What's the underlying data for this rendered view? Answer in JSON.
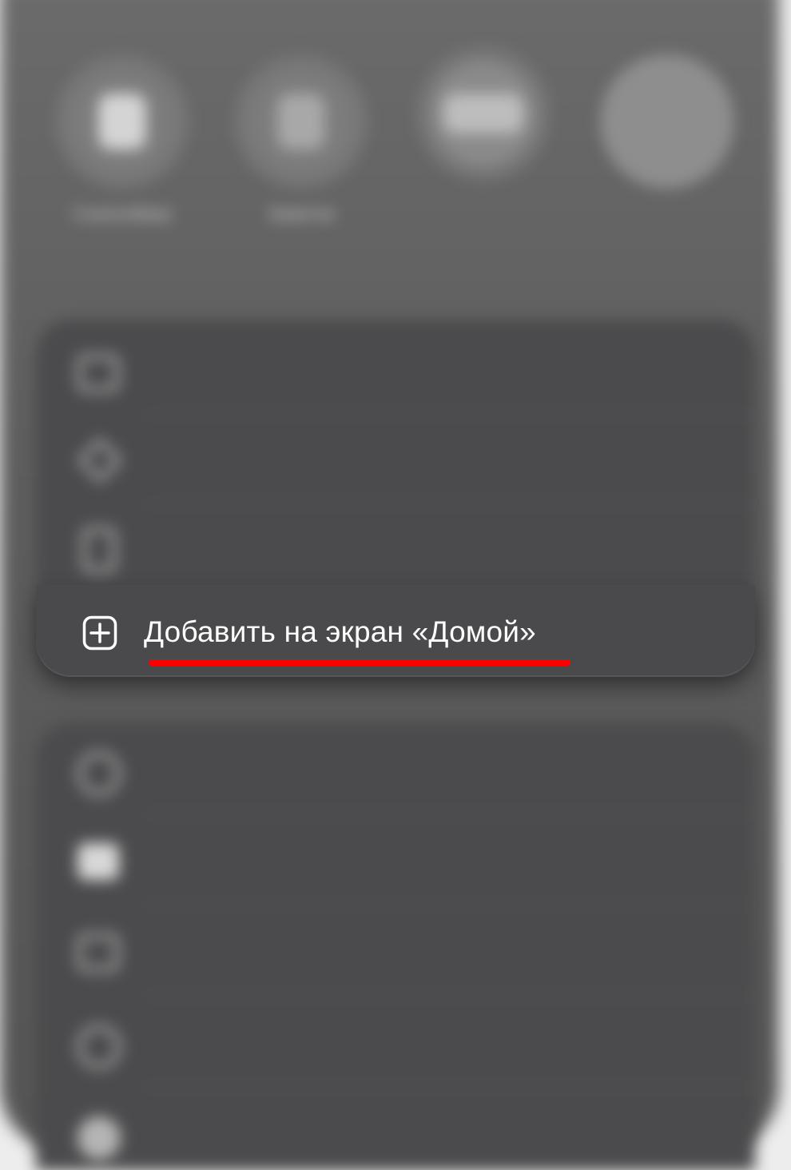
{
  "top_apps": [
    {
      "label": "Снапсейвер",
      "icon": "app-icon"
    },
    {
      "label": "Заметки",
      "icon": "app-icon"
    },
    {
      "label": "",
      "icon": "app-icon"
    },
    {
      "label": "",
      "icon": "app-icon"
    }
  ],
  "actions_group_1": [
    {
      "icon": "book-open-icon",
      "label": ""
    },
    {
      "icon": "star-icon",
      "label": ""
    },
    {
      "icon": "find-on-page-icon",
      "label": ""
    }
  ],
  "highlighted_action": {
    "icon": "plus-square-icon",
    "label": "Добавить на экран «Домой»",
    "underline_color": "#ff0000"
  },
  "actions_group_2": [
    {
      "icon": "person-circle-icon",
      "label": ""
    },
    {
      "icon": "markup-icon",
      "label": ""
    },
    {
      "icon": "home-icon",
      "label": ""
    },
    {
      "icon": "cloud-icon",
      "label": ""
    },
    {
      "icon": "compass-icon",
      "label": ""
    }
  ],
  "colors": {
    "sheet_background": "#5e5e5e",
    "group_background": "#4b4b4d",
    "highlight_text": "#ffffff",
    "accent_underline": "#ff0000"
  }
}
